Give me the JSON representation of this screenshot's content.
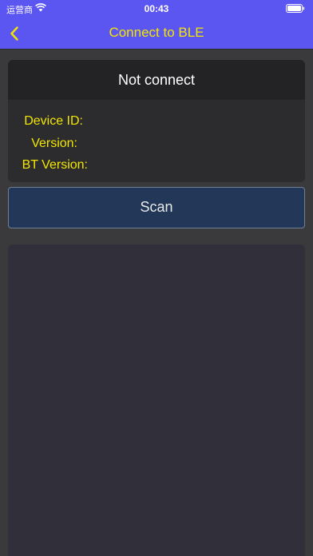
{
  "status_bar": {
    "carrier": "运营商",
    "time": "00:43",
    "wifi_icon": "wifi-icon",
    "battery_icon": "battery-icon"
  },
  "nav": {
    "title": "Connect to BLE",
    "back_icon": "chevron-left-icon"
  },
  "info": {
    "connection_status": "Not connect",
    "device_id_label": "Device ID:",
    "version_label": "Version:",
    "bt_version_label": "BT Version:"
  },
  "scan": {
    "label": "Scan"
  },
  "colors": {
    "nav_background": "#5b55f2",
    "accent_yellow": "#f2e600",
    "page_background": "#3a3a3c",
    "scan_button": "#233858"
  }
}
